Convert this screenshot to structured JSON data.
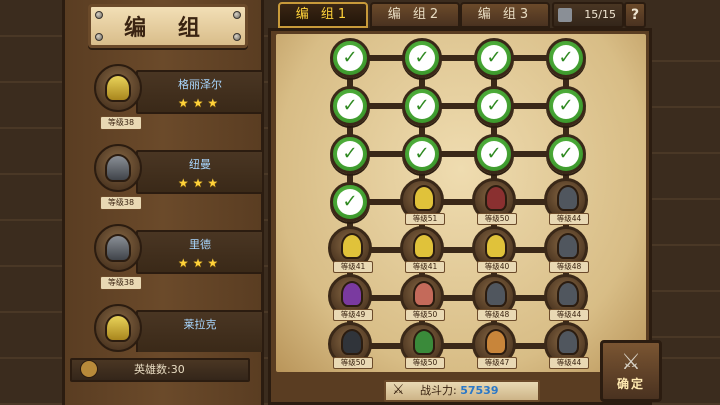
{
  "title": "编 组",
  "tabs": [
    {
      "label": "编 组1",
      "active": true
    },
    {
      "label": "编 组2",
      "active": false
    },
    {
      "label": "编 组3",
      "active": false
    }
  ],
  "hero_capacity": "15/15",
  "help_label": "?",
  "heroes": [
    {
      "name": "格丽泽尔",
      "stars": "★★★",
      "level": "等级38",
      "icon": "golden-helmet-knight"
    },
    {
      "name": "纽曼",
      "stars": "★★★",
      "level": "等级38",
      "icon": "dark-armored-knight"
    },
    {
      "name": "里德",
      "stars": "★★★",
      "level": "等级38",
      "icon": "dark-armored-knight"
    },
    {
      "name": "莱拉克",
      "stars": "",
      "level": "",
      "icon": "golden-helmet-knight"
    }
  ],
  "hero_count_label": "英雄数:30",
  "grid": {
    "rows": 7,
    "cols": 4,
    "cells": [
      [
        "check",
        "check",
        "check",
        "check"
      ],
      [
        "check",
        "check",
        "check",
        "check"
      ],
      [
        "check",
        "check",
        "check",
        "check"
      ],
      [
        "check",
        "等级51",
        "等级50",
        "等级44"
      ],
      [
        "等级41",
        "等级41",
        "等级40",
        "等级48"
      ],
      [
        "等级49",
        "等级50",
        "等级48",
        "等级44"
      ],
      [
        "等级50",
        "等级50",
        "等级47",
        "等级44"
      ]
    ],
    "unit_colors": [
      [
        null,
        null,
        null,
        null
      ],
      [
        null,
        null,
        null,
        null
      ],
      [
        null,
        null,
        null,
        null
      ],
      [
        null,
        "#e0c23a",
        "#8a3030",
        "#50565e"
      ],
      [
        "#e0c23a",
        "#e0c23a",
        "#e0c23a",
        "#50565e"
      ],
      [
        "#7a3aa0",
        "#c46a5a",
        "#50565e",
        "#50565e"
      ],
      [
        "#30343a",
        "#3a8a3a",
        "#c8853a",
        "#50565e"
      ]
    ]
  },
  "battle_power_label": "战斗力:",
  "battle_power_value": "57539",
  "confirm_label": "确定"
}
